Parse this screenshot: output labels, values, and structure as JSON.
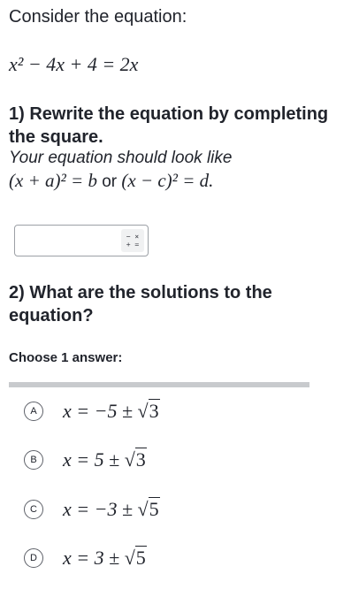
{
  "intro": "Consider the equation:",
  "equation": "x² − 4x + 4 = 2x",
  "question1": {
    "title": "1) Rewrite the equation by completing the square.",
    "hint": "Your equation should look like",
    "form_a": "(x + a)² = b",
    "or_text": "or",
    "form_b": "(x − c)² = d.",
    "input_value": "",
    "keypad_icon": "math-keypad-icon",
    "keypad_glyph_top": "− ×",
    "keypad_glyph_bottom": "+ ="
  },
  "question2": {
    "title": "2) What are the solutions to the equation?",
    "choose_label": "Choose 1 answer:",
    "choices": [
      {
        "letter": "A",
        "prefix": "x = −5 ± ",
        "radicand": "3"
      },
      {
        "letter": "B",
        "prefix": "x = 5 ± ",
        "radicand": "3"
      },
      {
        "letter": "C",
        "prefix": "x = −3 ± ",
        "radicand": "5"
      },
      {
        "letter": "D",
        "prefix": "x = 3 ± ",
        "radicand": "5"
      }
    ]
  }
}
